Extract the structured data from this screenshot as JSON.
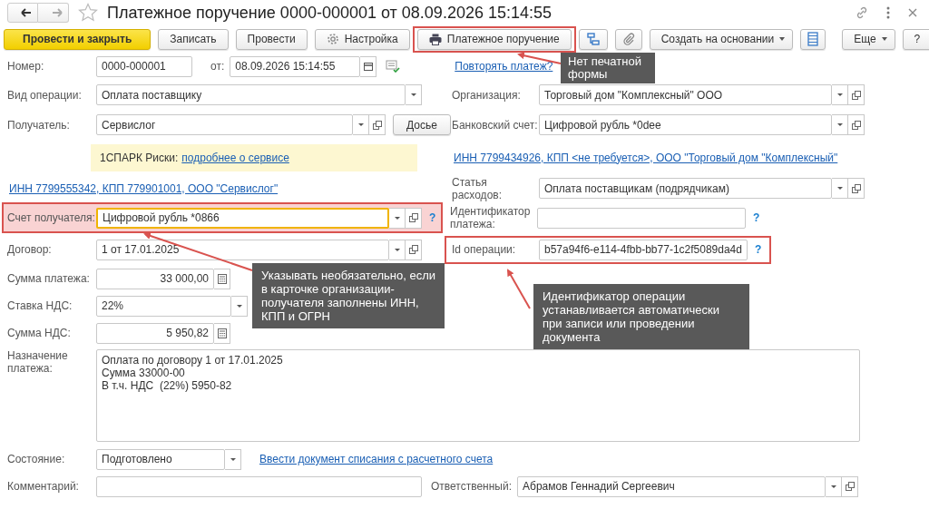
{
  "window": {
    "title": "Платежное поручение 0000-000001 от 08.09.2026 15:14:55",
    "favorite": false
  },
  "toolbar": [
    {
      "kind": "primary",
      "label": "Провести и закрыть",
      "highlighted": false
    },
    {
      "kind": "plain",
      "label": "Записать",
      "highlighted": false
    },
    {
      "kind": "plain",
      "label": "Провести",
      "highlighted": false
    },
    {
      "kind": "gear",
      "label": "Настройка",
      "highlighted": false
    },
    {
      "kind": "print",
      "label": "Платежное поручение",
      "highlighted": true
    },
    {
      "kind": "structure"
    },
    {
      "kind": "attach"
    },
    {
      "kind": "menu",
      "label": "Создать на основании"
    },
    {
      "kind": "list"
    },
    {
      "kind": "menu",
      "label": "Еще"
    },
    {
      "kind": "plain",
      "label": "?"
    }
  ],
  "number_row": {
    "number_label": "Номер:",
    "number": "0000-000001",
    "date_label": "от:",
    "date": "08.09.2026 15:14:55",
    "repeat_link": "Повторять платеж?"
  },
  "rows": [
    {
      "left": {
        "kind": "dropdown",
        "label": "Вид операции:",
        "value": "Оплата поставщику"
      },
      "right": {
        "kind": "select",
        "label": "Организация:",
        "value": "Торговый дом \"Комплексный\" ООО"
      }
    },
    {
      "left": {
        "kind": "select",
        "label": "Получатель:",
        "value": "Сервислог",
        "button": "Досье"
      },
      "right": {
        "kind": "select",
        "label": "Банковский счет:",
        "value": "Цифровой рубль *0dee"
      }
    },
    {
      "left": {
        "kind": "notice",
        "text": "1СПАРК Риски:",
        "link": "подробнее о сервисе"
      },
      "right": {
        "kind": "link",
        "text": "ИНН 7799434926, КПП <не требуется>, ООО \"Торговый дом \"Комплексный\""
      }
    },
    {
      "left": {
        "kind": "link",
        "text": "ИНН 7799555342, КПП 779901001, ООО \"Сервислог\""
      },
      "right": {
        "kind": "select",
        "label": "Статья расходов:",
        "value": "Оплата поставщикам (подрядчикам)"
      }
    },
    {
      "left": {
        "kind": "select",
        "label": "Счет получателя:",
        "value": "Цифровой рубль *0866",
        "help": "?",
        "highlighted": true,
        "focused": true
      },
      "right": {
        "kind": "input",
        "label": "Идентификатор платежа:",
        "help": "?"
      }
    },
    {
      "left": {
        "kind": "select",
        "label": "Договор:",
        "value": "1 от 17.01.2025"
      },
      "right": {
        "kind": "input",
        "label": "Id операции:",
        "value": "b57a94f6-e114-4fbb-bb77-1c2f5089da4d",
        "help": "?",
        "highlighted": true
      }
    }
  ],
  "amounts": [
    {
      "label": "Сумма платежа:",
      "value": "33 000,00",
      "kind": "amount"
    },
    {
      "label": "Ставка НДС:",
      "value": "22%",
      "kind": "dropdown"
    },
    {
      "label": "Сумма НДС:",
      "value": "5 950,82",
      "kind": "amount"
    }
  ],
  "purpose": {
    "label": "Назначение платежа:",
    "lines": [
      "Оплата по договору 1 от 17.01.2025",
      "Сумма 33000-00",
      "В т.ч. НДС  (22%) 5950-82"
    ]
  },
  "state": {
    "label": "Состояние:",
    "value": "Подготовлено",
    "link": "Ввести документ списания с расчетного счета"
  },
  "comment": {
    "label": "Комментарий:",
    "responsible_label": "Ответственный:",
    "responsible": "Абрамов Геннадий Сергеевич"
  },
  "callouts": [
    "Нет печатной формы",
    "Указывать необязательно, если в карточке организации-получателя заполнены ИНН, КПП и ОГРН",
    "Идентификатор операции устанавливается автоматически при записи или проведении документа"
  ]
}
